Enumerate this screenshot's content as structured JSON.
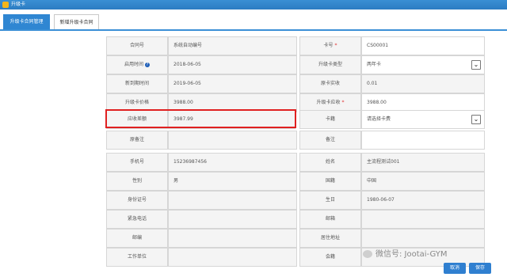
{
  "window": {
    "title": "升级卡"
  },
  "tabs": [
    {
      "label": "升级卡合同管理"
    },
    {
      "label": "新增升级卡合同"
    }
  ],
  "form": {
    "contract_no": {
      "label": "合同号",
      "value": "系统自动编号"
    },
    "card_no": {
      "label": "卡号",
      "value": "CS00001",
      "required": "*"
    },
    "enable_time": {
      "label": "启用时间",
      "value": "2018-06-05"
    },
    "upgrade_type": {
      "label": "升级卡类型",
      "value": "两年卡"
    },
    "new_expire": {
      "label": "新到期时间",
      "value": "2019-06-05"
    },
    "original_paid": {
      "label": "原卡实收",
      "value": "0.01"
    },
    "upgrade_price": {
      "label": "升级卡价格",
      "value": "3988.00"
    },
    "upgrade_due": {
      "label": "升级卡应收",
      "value": "3988.00",
      "required": "*"
    },
    "receivable": {
      "label": "应收差额",
      "value": "3987.99"
    },
    "card_tag": {
      "label": "卡籍",
      "value": "请选择卡费"
    },
    "orig_note": {
      "label": "原备注",
      "value": ""
    },
    "note": {
      "label": "备注",
      "value": ""
    },
    "phone": {
      "label": "手机号",
      "value": "15236987456"
    },
    "name": {
      "label": "姓名",
      "value": "主流程测试001"
    },
    "gender": {
      "label": "性别",
      "value": "男"
    },
    "nationality": {
      "label": "国籍",
      "value": "中国"
    },
    "id_no": {
      "label": "身份证号",
      "value": ""
    },
    "birthday": {
      "label": "生日",
      "value": "1980-06-07"
    },
    "emergency": {
      "label": "紧急电话",
      "value": ""
    },
    "email": {
      "label": "邮箱",
      "value": ""
    },
    "mail": {
      "label": "邮编",
      "value": ""
    },
    "address": {
      "label": "居住地址",
      "value": ""
    },
    "work_unit": {
      "label": "工作单位",
      "value": ""
    },
    "club": {
      "label": "会籍",
      "value": ""
    }
  },
  "buttons": {
    "cancel": "取消",
    "save": "保存"
  },
  "watermark": "微信号: Jootai-GYM",
  "colors": {
    "accent": "#2f86d2",
    "highlight": "#e02020"
  }
}
